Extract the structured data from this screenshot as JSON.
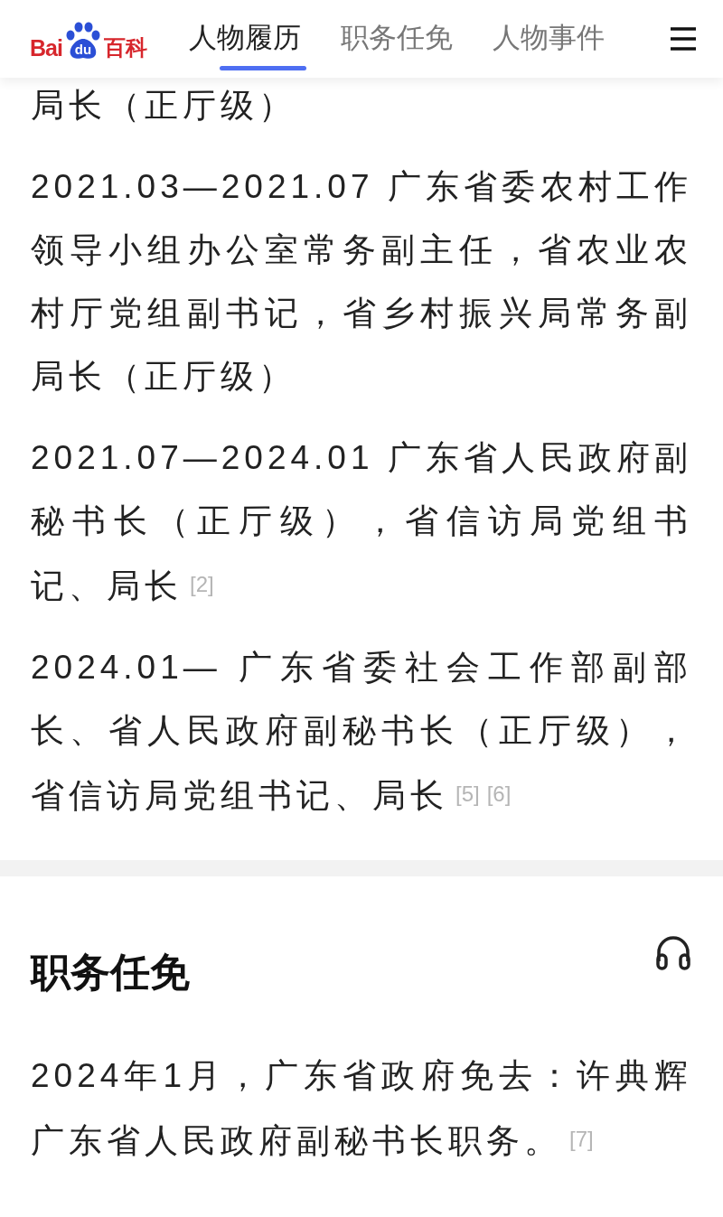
{
  "header": {
    "logo": {
      "left": "Bai",
      "paw": "du",
      "right": "百科"
    },
    "tabs": [
      {
        "label": "人物履历",
        "selected": true
      },
      {
        "label": "职务任免",
        "selected": false
      },
      {
        "label": "人物事件",
        "selected": false
      }
    ]
  },
  "career": {
    "entries": [
      {
        "text": "局长（正厅级）"
      },
      {
        "text": "2021.03—2021.07 广东省委农村工作领导小组办公室常务副主任，省农业农村厅党组副书记，省乡村振兴局常务副局长（正厅级）"
      },
      {
        "text": "2021.07—2024.01 广东省人民政府副秘书长（正厅级），省信访局党组书记、局长",
        "refs": [
          "[2]"
        ]
      },
      {
        "text": "2024.01— 广东省委社会工作部副部长、省人民政府副秘书长（正厅级），省信访局党组书记、局长",
        "refs": [
          "[5]",
          "[6]"
        ]
      }
    ]
  },
  "appointments": {
    "title": "职务任免",
    "entries": [
      {
        "text": "2024年1月，广东省政府免去：许典辉广东省人民政府副秘书长职务。",
        "refs": [
          "[7]"
        ]
      }
    ]
  }
}
